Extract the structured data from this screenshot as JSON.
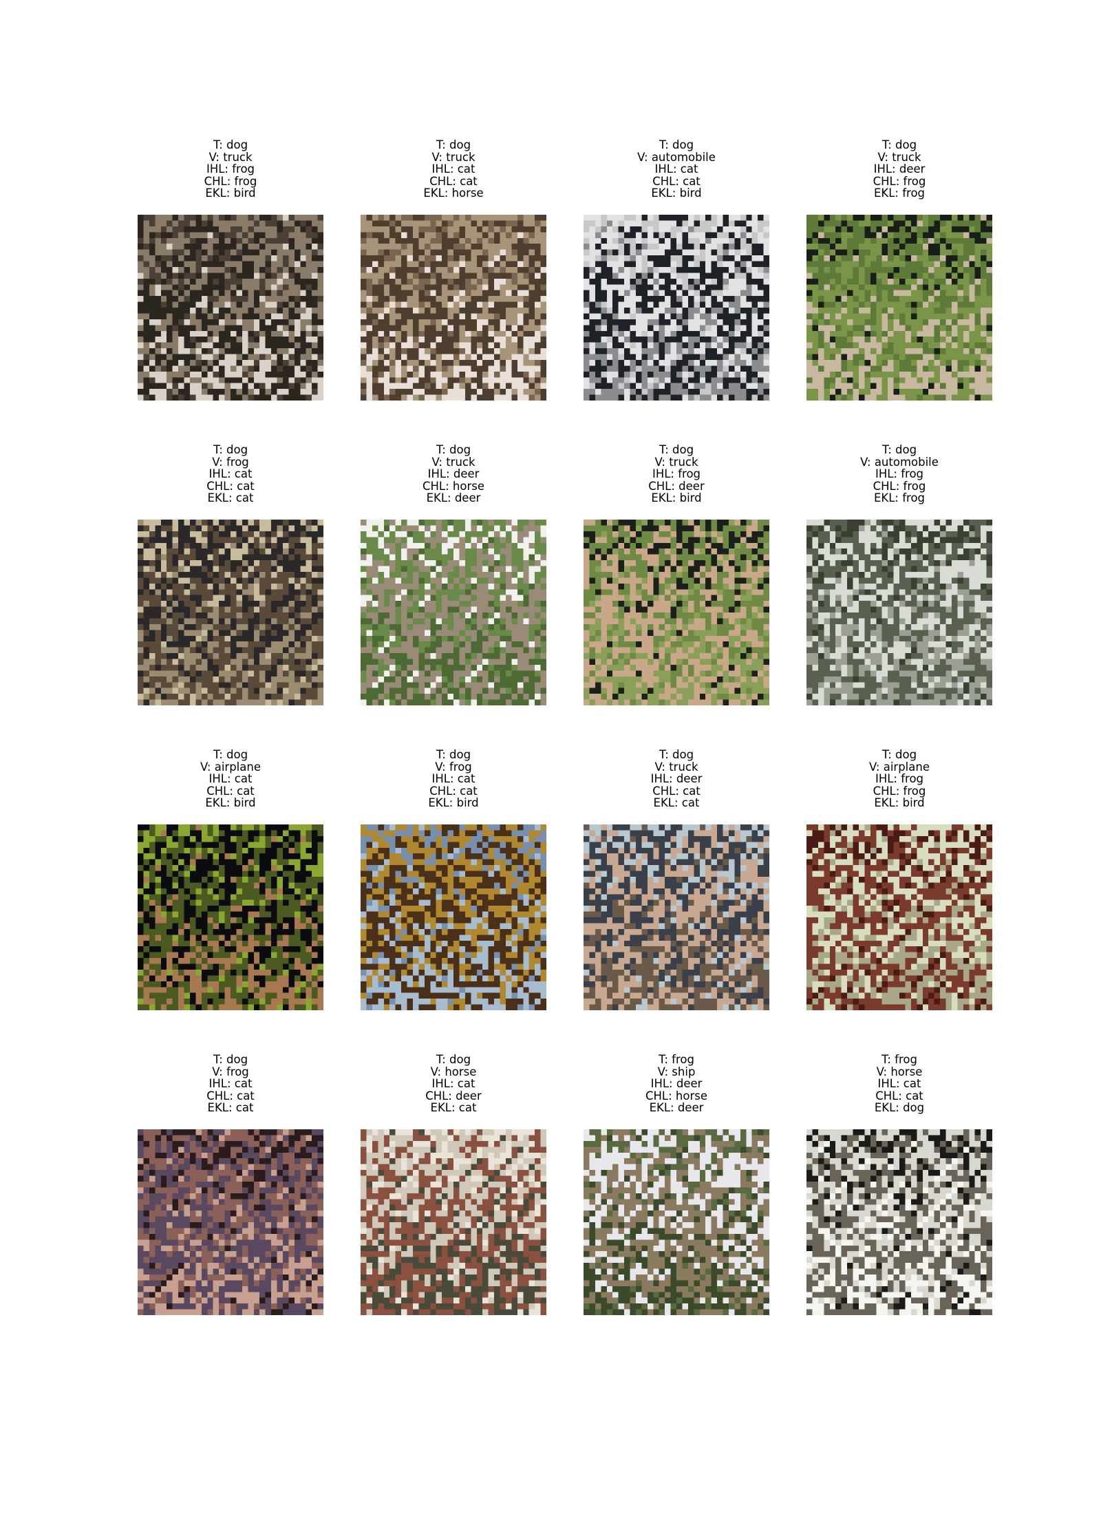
{
  "panels": [
    {
      "image": "pixelated-dog-photo",
      "t": "T: dog",
      "v": "V: truck",
      "ihl": "IHL: frog",
      "chl": "CHL: frog",
      "ekl": "EKL: bird",
      "colors": [
        "#4a4038",
        "#8a7a68",
        "#2c2620",
        "#d8d2c8"
      ]
    },
    {
      "image": "pixelated-dog-photo",
      "t": "T: dog",
      "v": "V: truck",
      "ihl": "IHL: cat",
      "chl": "CHL: cat",
      "ekl": "EKL: horse",
      "colors": [
        "#7a6650",
        "#a89478",
        "#4e3e30",
        "#e8e0d8"
      ]
    },
    {
      "image": "pixelated-dog-photo",
      "t": "T: dog",
      "v": "V: automobile",
      "ihl": "IHL: cat",
      "chl": "CHL: cat",
      "ekl": "EKL: bird",
      "colors": [
        "#c8c8c8",
        "#e2e2e2",
        "#1e2228",
        "#8a8c90"
      ]
    },
    {
      "image": "pixelated-dog-photo",
      "t": "T: dog",
      "v": "V: truck",
      "ihl": "IHL: deer",
      "chl": "CHL: frog",
      "ekl": "EKL: frog",
      "colors": [
        "#1a1e18",
        "#5e7a38",
        "#7a9448",
        "#c8b8a0"
      ]
    },
    {
      "image": "pixelated-dog-photo",
      "t": "T: dog",
      "v": "V: frog",
      "ihl": "IHL: cat",
      "chl": "CHL: cat",
      "ekl": "EKL: cat",
      "colors": [
        "#c8bc9c",
        "#2a2828",
        "#5a4a3a",
        "#9a8c70"
      ]
    },
    {
      "image": "pixelated-dog-photo",
      "t": "T: dog",
      "v": "V: truck",
      "ihl": "IHL: deer",
      "chl": "CHL: horse",
      "ekl": "EKL: deer",
      "colors": [
        "#f0f0ec",
        "#6a8a4a",
        "#9a8a78",
        "#4e6a34"
      ]
    },
    {
      "image": "pixelated-dog-photo",
      "t": "T: dog",
      "v": "V: truck",
      "ihl": "IHL: frog",
      "chl": "CHL: deer",
      "ekl": "EKL: bird",
      "colors": [
        "#1c201a",
        "#6e8a44",
        "#c8a888",
        "#8aa058"
      ]
    },
    {
      "image": "pixelated-dog-photo",
      "t": "T: dog",
      "v": "V: automobile",
      "ihl": "IHL: frog",
      "chl": "CHL: frog",
      "ekl": "EKL: frog",
      "colors": [
        "#3a4030",
        "#d8dcd4",
        "#5a6050",
        "#9ca094"
      ]
    },
    {
      "image": "pixelated-dog-photo",
      "t": "T: dog",
      "v": "V: airplane",
      "ihl": "IHL: cat",
      "chl": "CHL: cat",
      "ekl": "EKL: bird",
      "colors": [
        "#8aa830",
        "#0c0c10",
        "#4a5a20",
        "#a87850"
      ]
    },
    {
      "image": "pixelated-dog-photo",
      "t": "T: dog",
      "v": "V: frog",
      "ihl": "IHL: cat",
      "chl": "CHL: cat",
      "ekl": "EKL: bird",
      "colors": [
        "#7890b0",
        "#b08830",
        "#4a3018",
        "#a8bcd0"
      ]
    },
    {
      "image": "pixelated-dog-photo",
      "t": "T: dog",
      "v": "V: truck",
      "ihl": "IHL: deer",
      "chl": "CHL: cat",
      "ekl": "EKL: cat",
      "colors": [
        "#b8c8d0",
        "#3a404a",
        "#c8a890",
        "#6a5a4a"
      ]
    },
    {
      "image": "pixelated-dog-photo",
      "t": "T: dog",
      "v": "V: airplane",
      "ihl": "IHL: frog",
      "chl": "CHL: frog",
      "ekl": "EKL: bird",
      "colors": [
        "#4a1a14",
        "#d8dcc0",
        "#7a3a2c",
        "#a8a888"
      ]
    },
    {
      "image": "pixelated-dog-photo",
      "t": "T: dog",
      "v": "V: frog",
      "ihl": "IHL: cat",
      "chl": "CHL: cat",
      "ekl": "EKL: cat",
      "colors": [
        "#2a1c1c",
        "#8a6058",
        "#5a4860",
        "#c8a090"
      ]
    },
    {
      "image": "pixelated-dog-photo",
      "t": "T: dog",
      "v": "V: horse",
      "ihl": "IHL: cat",
      "chl": "CHL: deer",
      "ekl": "EKL: cat",
      "colors": [
        "#e8e4d8",
        "#d0c8b8",
        "#8a5040",
        "#4a4a3a"
      ]
    },
    {
      "image": "pixelated-dog-photo",
      "t": "T: frog",
      "v": "V: ship",
      "ihl": "IHL: deer",
      "chl": "CHL: horse",
      "ekl": "EKL: deer",
      "colors": [
        "#5a6a40",
        "#e8e8ec",
        "#8a7a60",
        "#3a4a2a"
      ]
    },
    {
      "image": "pixelated-dog-photo",
      "t": "T: frog",
      "v": "V: horse",
      "ihl": "IHL: cat",
      "chl": "CHL: cat",
      "ekl": "EKL: dog",
      "colors": [
        "#1a1a18",
        "#d8d8d0",
        "#6a6458",
        "#f4f4f0"
      ]
    }
  ]
}
